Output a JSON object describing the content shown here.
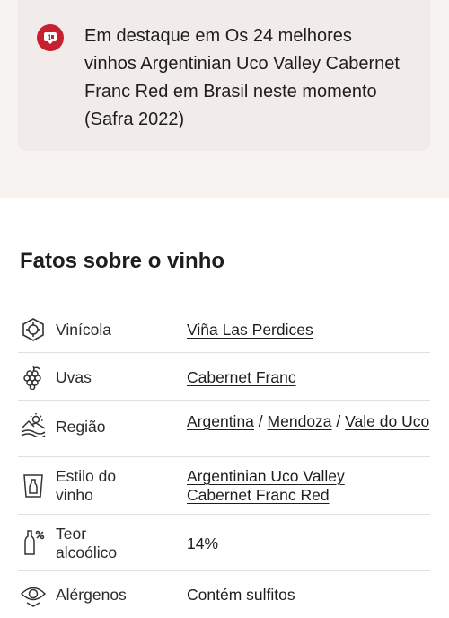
{
  "highlight": {
    "text": "Em destaque em Os 24 melhores vinhos Argentinian Uco Valley Cabernet Franc Red em Brasil neste momento (Safra 2022)",
    "badge_icon": "award-badge-icon",
    "badge_color": "#c7202f"
  },
  "facts": {
    "title": "Fatos sobre o vinho",
    "winery": {
      "label": "Vinícola",
      "value": "Viña Las Perdices",
      "icon": "winery-icon"
    },
    "grapes": {
      "label": "Uvas",
      "value": "Cabernet Franc",
      "icon": "grapes-icon"
    },
    "region": {
      "label": "Região",
      "parts": [
        "Argentina",
        "Mendoza",
        "Vale do Uco"
      ],
      "separator": "/",
      "icon": "region-landscape-icon"
    },
    "style": {
      "label_line1": "Estilo do",
      "label_line2": "vinho",
      "value": "Argentinian Uco Valley Cabernet Franc Red",
      "icon": "wine-bottle-icon"
    },
    "alcohol": {
      "label_line1": "Teor",
      "label_line2": "alcoólico",
      "value": "14%",
      "icon": "alcohol-percent-icon"
    },
    "allergens": {
      "label": "Alérgenos",
      "value": "Contém sulfitos",
      "icon": "eye-icon"
    }
  }
}
